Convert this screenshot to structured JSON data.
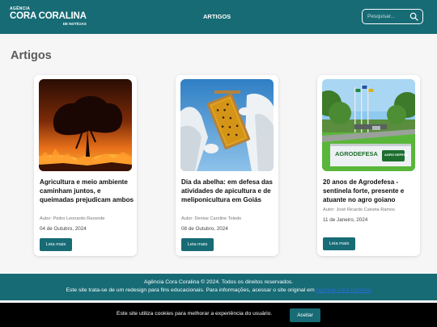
{
  "header": {
    "logo_line1": "AGÊNCIA",
    "logo_line2": "CORA CORALINA",
    "logo_line3": "DE NOTÍCIAS",
    "nav_artigos": "ARTIGOS",
    "search_placeholder": "Pesquisar...",
    "search_icon": "search-icon"
  },
  "main": {
    "title": "Artigos",
    "cards": [
      {
        "image": "fire-savanna-photo",
        "title": "Agricultura e meio ambiente caminham juntos, e queimadas prejudicam ambos",
        "author": "Autor: Pedro Leonardo Rezende",
        "date": "04 de Outubro, 2024",
        "button": "Leia mais"
      },
      {
        "image": "beekeeper-honeycomb-photo",
        "title": "Dia da abelha: em defesa das atividades de apicultura e de meliponicultura em Goiás",
        "author": "Autor: Denise Caroline Toledo",
        "date": "08 de Outubro, 2024",
        "button": "Leia mais"
      },
      {
        "image": "agrodefesa-building-photo",
        "title": "20 anos de Agrodefesa - sentinela forte, presente e atuante no agro goiano",
        "author": "Autor: José Ricardo Caixeta Ramos",
        "date": "11 de Janeiro, 2024",
        "button": "Leia mais",
        "sign_text": "AGRODEFESA",
        "sign_logo_text": "AGRO DEFESA"
      }
    ]
  },
  "footer": {
    "line1": "Agência Cora Coralina © 2024. Todos os direitos reservados.",
    "line2": "Este site trata-se de um redesign para fins educacionais. Para informações, acessar o site original em",
    "link": "Agência Cora Coralina"
  },
  "cookie": {
    "text": "Este site utiliza cookies para melhorar a experiência do usuário.",
    "button": "Aceitar"
  },
  "colors": {
    "brand": "#176b75",
    "page_bg": "#f6f6f6",
    "cookie_bg": "#000000"
  }
}
